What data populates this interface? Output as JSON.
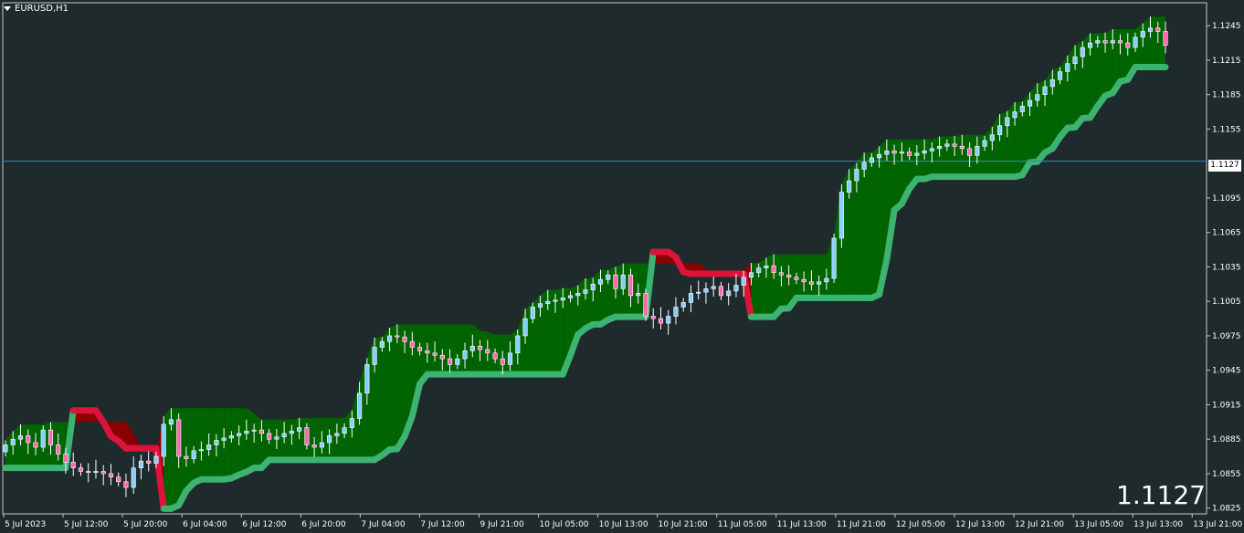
{
  "header": {
    "symbol_label": "EURUSD,H1"
  },
  "current_price_label": "1.1127",
  "colors": {
    "background": "#1f2a2d",
    "bull_cloud": "#006400",
    "bear_cloud": "#8b0000",
    "line_up": "#3cb371",
    "line_down": "#dc143c",
    "candle_bull": "#87cefa",
    "candle_bear": "#ff69b4",
    "price_line": "#3a86c8",
    "axis_text": "#ffffff"
  },
  "chart_data": {
    "type": "candlestick",
    "symbol": "EURUSD",
    "timeframe": "H1",
    "ylim": [
      1.082,
      1.1265
    ],
    "y_ticks": [
      "1.1245",
      "1.1215",
      "1.1185",
      "1.1155",
      "1.1095",
      "1.1065",
      "1.1035",
      "1.1005",
      "1.0975",
      "1.0945",
      "1.0915",
      "1.0885",
      "1.0855",
      "1.0825"
    ],
    "x_ticks": [
      "5 Jul 2023",
      "5 Jul 12:00",
      "5 Jul 20:00",
      "6 Jul 04:00",
      "6 Jul 12:00",
      "6 Jul 20:00",
      "7 Jul 04:00",
      "7 Jul 12:00",
      "9 Jul 21:00",
      "10 Jul 05:00",
      "10 Jul 13:00",
      "10 Jul 21:00",
      "11 Jul 05:00",
      "11 Jul 13:00",
      "11 Jul 21:00",
      "12 Jul 05:00",
      "12 Jul 13:00",
      "12 Jul 21:00",
      "13 Jul 05:00",
      "13 Jul 13:00",
      "13 Jul 21:00"
    ],
    "current_price": 1.1127,
    "closes": [
      1.088,
      1.0885,
      1.0888,
      1.0882,
      1.0878,
      1.0893,
      1.088,
      1.0872,
      1.0865,
      1.086,
      1.0857,
      1.0856,
      1.0857,
      1.0855,
      1.0852,
      1.0848,
      1.0843,
      1.086,
      1.0866,
      1.0864,
      1.087,
      1.0898,
      1.0902,
      1.087,
      1.0868,
      1.0875,
      1.0876,
      1.088,
      1.0884,
      1.0886,
      1.0888,
      1.089,
      1.0892,
      1.0893,
      1.089,
      1.0885,
      1.0887,
      1.089,
      1.0892,
      1.0895,
      1.088,
      1.0878,
      1.0882,
      1.0888,
      1.089,
      1.0895,
      1.0903,
      1.0925,
      1.095,
      1.0965,
      1.097,
      1.0975,
      1.0974,
      1.097,
      1.0965,
      1.0962,
      1.096,
      1.0958,
      1.0955,
      1.095,
      1.0955,
      1.0962,
      1.0966,
      1.0963,
      1.096,
      1.0955,
      1.095,
      1.096,
      1.0975,
      1.099,
      1.1,
      1.1003,
      1.1005,
      1.1006,
      1.1008,
      1.101,
      1.1012,
      1.1015,
      1.102,
      1.1024,
      1.1028,
      1.1016,
      1.1028,
      1.101,
      1.1012,
      1.0992,
      1.099,
      1.0986,
      1.0992,
      1.1,
      1.1004,
      1.1012,
      1.1013,
      1.1016,
      1.1018,
      1.101,
      1.1014,
      1.1019,
      1.1026,
      1.103,
      1.1034,
      1.1036,
      1.103,
      1.1028,
      1.1026,
      1.1024,
      1.1022,
      1.102,
      1.1022,
      1.1025,
      1.106,
      1.11,
      1.111,
      1.112,
      1.1126,
      1.113,
      1.1133,
      1.1136,
      1.1134,
      1.1135,
      1.1132,
      1.1134,
      1.1136,
      1.1138,
      1.114,
      1.1142,
      1.114,
      1.1138,
      1.1132,
      1.114,
      1.1145,
      1.115,
      1.1158,
      1.1165,
      1.117,
      1.1175,
      1.118,
      1.1185,
      1.1192,
      1.1198,
      1.1205,
      1.1212,
      1.1218,
      1.1226,
      1.123,
      1.1232,
      1.123,
      1.1232,
      1.123,
      1.1226,
      1.1235,
      1.124,
      1.1243,
      1.124,
      1.1228
    ]
  }
}
